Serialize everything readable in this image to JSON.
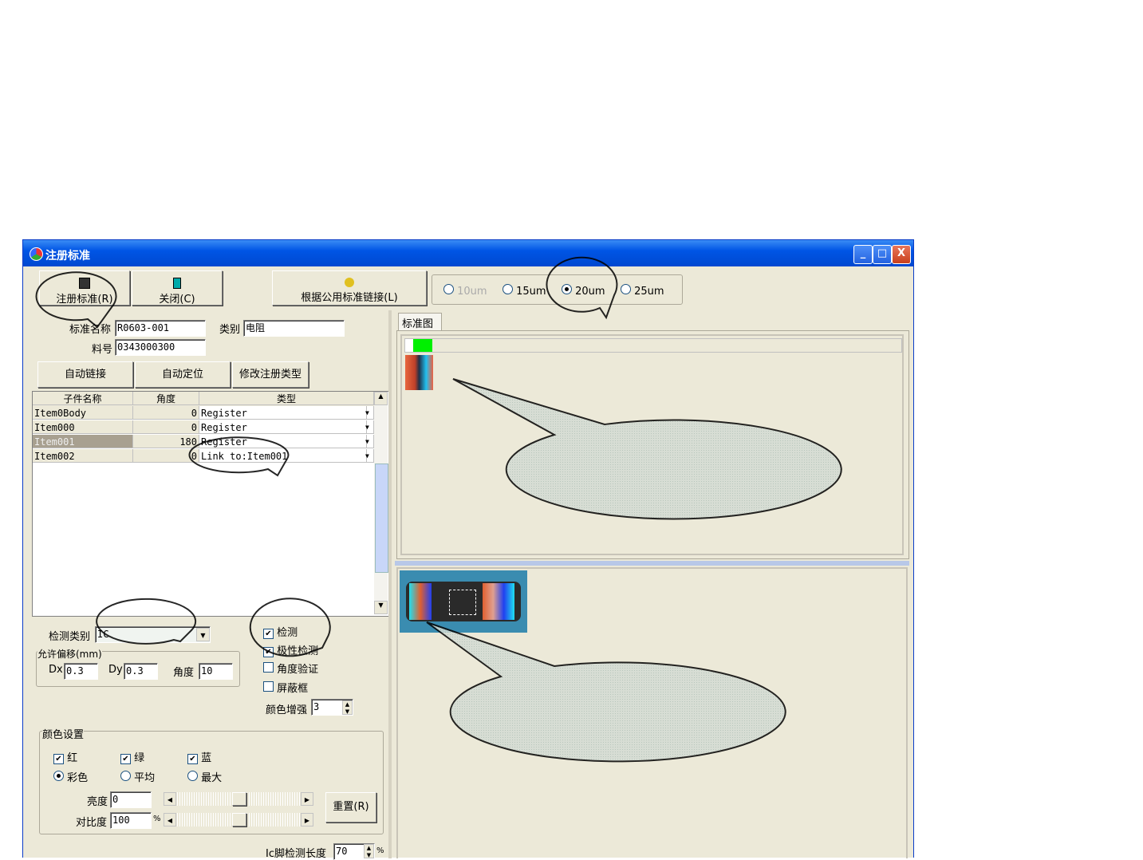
{
  "window": {
    "title": "注册标准",
    "minimize": "_",
    "maximize": "□",
    "close": "X"
  },
  "toolbar": {
    "register": "注册标准(R)",
    "close": "关闭(C)",
    "link_public": "根据公用标准链接(L)"
  },
  "resolution": {
    "options": [
      {
        "label": "10um",
        "selected": false,
        "disabled": true
      },
      {
        "label": "15um",
        "selected": false
      },
      {
        "label": "20um",
        "selected": true
      },
      {
        "label": "25um",
        "selected": false
      }
    ]
  },
  "form": {
    "std_name_label": "标准名称",
    "std_name": "R0603-001",
    "category_label": "类别",
    "category": "电阻",
    "part_no_label": "料号",
    "part_no": "0343000300"
  },
  "actions": {
    "auto_link": "自动链接",
    "auto_locate": "自动定位",
    "modify_type": "修改注册类型"
  },
  "table": {
    "headers": [
      "子件名称",
      "角度",
      "类型"
    ],
    "rows": [
      {
        "name": "Item0Body",
        "angle": "0",
        "type": "Register"
      },
      {
        "name": "Item000",
        "angle": "0",
        "type": "Register"
      },
      {
        "name": "Item001",
        "angle": "180",
        "type": "Register",
        "selected": true
      },
      {
        "name": "Item002",
        "angle": "0",
        "type": "Link to:Item001"
      }
    ]
  },
  "detect": {
    "type_label": "检测类别",
    "type_value": "IC",
    "offset_label": "允许偏移(mm)",
    "dx_label": "Dx",
    "dx": "0.3",
    "dy_label": "Dy",
    "dy": "0.3",
    "angle_label": "角度",
    "angle": "10",
    "checks": [
      {
        "label": "检测",
        "checked": true
      },
      {
        "label": "极性检测",
        "checked": true
      },
      {
        "label": "角度验证",
        "checked": false
      },
      {
        "label": "屏蔽框",
        "checked": false
      }
    ],
    "color_enhance_label": "颜色增强",
    "color_enhance": "3"
  },
  "color": {
    "group_label": "颜色设置",
    "channels": [
      {
        "label": "红",
        "checked": true
      },
      {
        "label": "绿",
        "checked": true
      },
      {
        "label": "蓝",
        "checked": true
      }
    ],
    "modes": [
      {
        "label": "彩色",
        "selected": true
      },
      {
        "label": "平均",
        "selected": false
      },
      {
        "label": "最大",
        "selected": false
      }
    ],
    "brightness_label": "亮度",
    "brightness": "0",
    "contrast_label": "对比度",
    "contrast": "100",
    "percent": "%",
    "reset": "重置(R)",
    "brightness_slider": 0.5,
    "contrast_slider": 0.5
  },
  "ic": {
    "label": "Ic脚检测长度",
    "value": "70",
    "percent": "%"
  },
  "right": {
    "tab": "标准图"
  },
  "colors": {
    "title": "#0055e5",
    "face": "#ece9d8",
    "callout": "#d4dcd4"
  }
}
